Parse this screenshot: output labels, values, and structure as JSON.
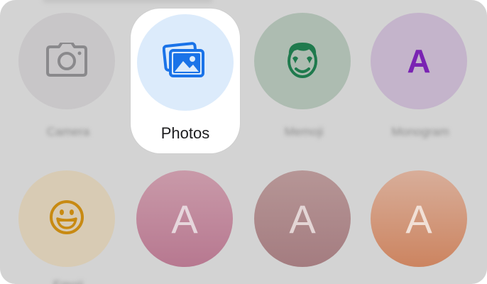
{
  "options_row1": [
    {
      "label": "Camera",
      "icon": "camera-icon",
      "bg": "#c8c6c8"
    },
    {
      "label": "Photos",
      "icon": "photos-icon",
      "bg": "#dcebfb",
      "selected": true
    },
    {
      "label": "Memoji",
      "icon": "memoji-icon",
      "bg": "#adbcb1"
    },
    {
      "label": "Monogram",
      "icon": "monogram-icon",
      "bg": "#c4b4cb",
      "letter": "A"
    }
  ],
  "options_row2": [
    {
      "label": "Emoji",
      "icon": "emoji-icon",
      "bg": "#d8cbb4"
    },
    {
      "label": "",
      "icon": "monogram-icon",
      "letter": "A"
    },
    {
      "label": "",
      "icon": "monogram-icon",
      "letter": "A"
    },
    {
      "label": "",
      "icon": "monogram-icon",
      "letter": "A"
    }
  ],
  "colors": {
    "sheet_bg": "#d3d3d3",
    "photos_blue": "#1a73e8",
    "memoji_green": "#1f7a4d",
    "monogram_purple": "#7a23b3",
    "emoji_gold": "#c88a12"
  }
}
